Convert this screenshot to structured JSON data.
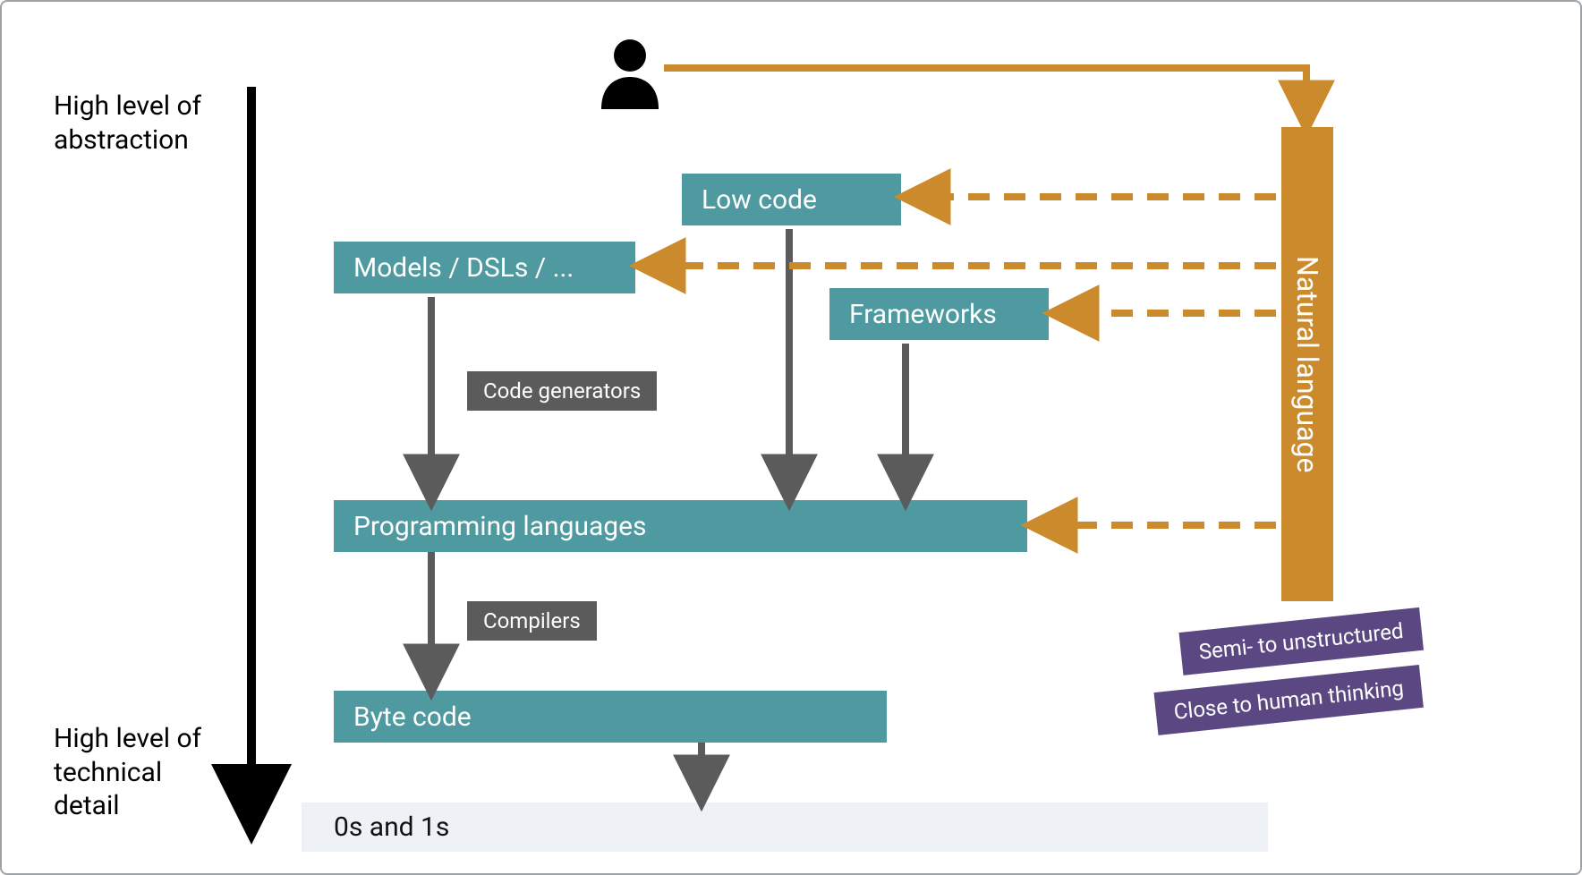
{
  "axis": {
    "top_label_line1": "High level of",
    "top_label_line2": "abstraction",
    "bottom_label_line1": "High level of",
    "bottom_label_line2": "technical",
    "bottom_label_line3": "detail"
  },
  "nodes": {
    "low_code": "Low code",
    "models_dsls": "Models / DSLs / ...",
    "frameworks": "Frameworks",
    "programming_languages": "Programming languages",
    "byte_code": "Byte code",
    "zeros_ones": "0s and 1s"
  },
  "tags": {
    "code_generators": "Code generators",
    "compilers": "Compilers"
  },
  "natural_language": {
    "label": "Natural language",
    "note1": "Semi- to unstructured",
    "note2": "Close to human thinking"
  },
  "colors": {
    "teal": "#4F9AA1",
    "dark_grey": "#5B5B5B",
    "gold": "#CB8A2C",
    "purple": "#5B4883",
    "light_grey": "#EEF1F5",
    "arrow_grey": "#5B5B5B"
  }
}
